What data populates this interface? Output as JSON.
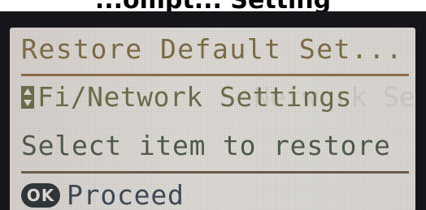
{
  "header": {
    "text": "...ompt... Setting"
  },
  "screen": {
    "title": "Restore Default Set...",
    "item_label": "Fi/Network Settings",
    "item_ghost": "Network Settings",
    "prompt": "Select item to restore",
    "ok_badge": "OK",
    "proceed_label": "Proceed"
  },
  "icons": {
    "scroll": "scroll-up-down-icon"
  },
  "colors": {
    "lcd_background": "#d8d4d0",
    "bezel": "#16161a",
    "title_text": "#7c6a45",
    "item_text": "#6c6a48",
    "prompt_text": "#4e5a48",
    "proceed_text": "#3c4856",
    "divider": "#8a6a4a"
  }
}
